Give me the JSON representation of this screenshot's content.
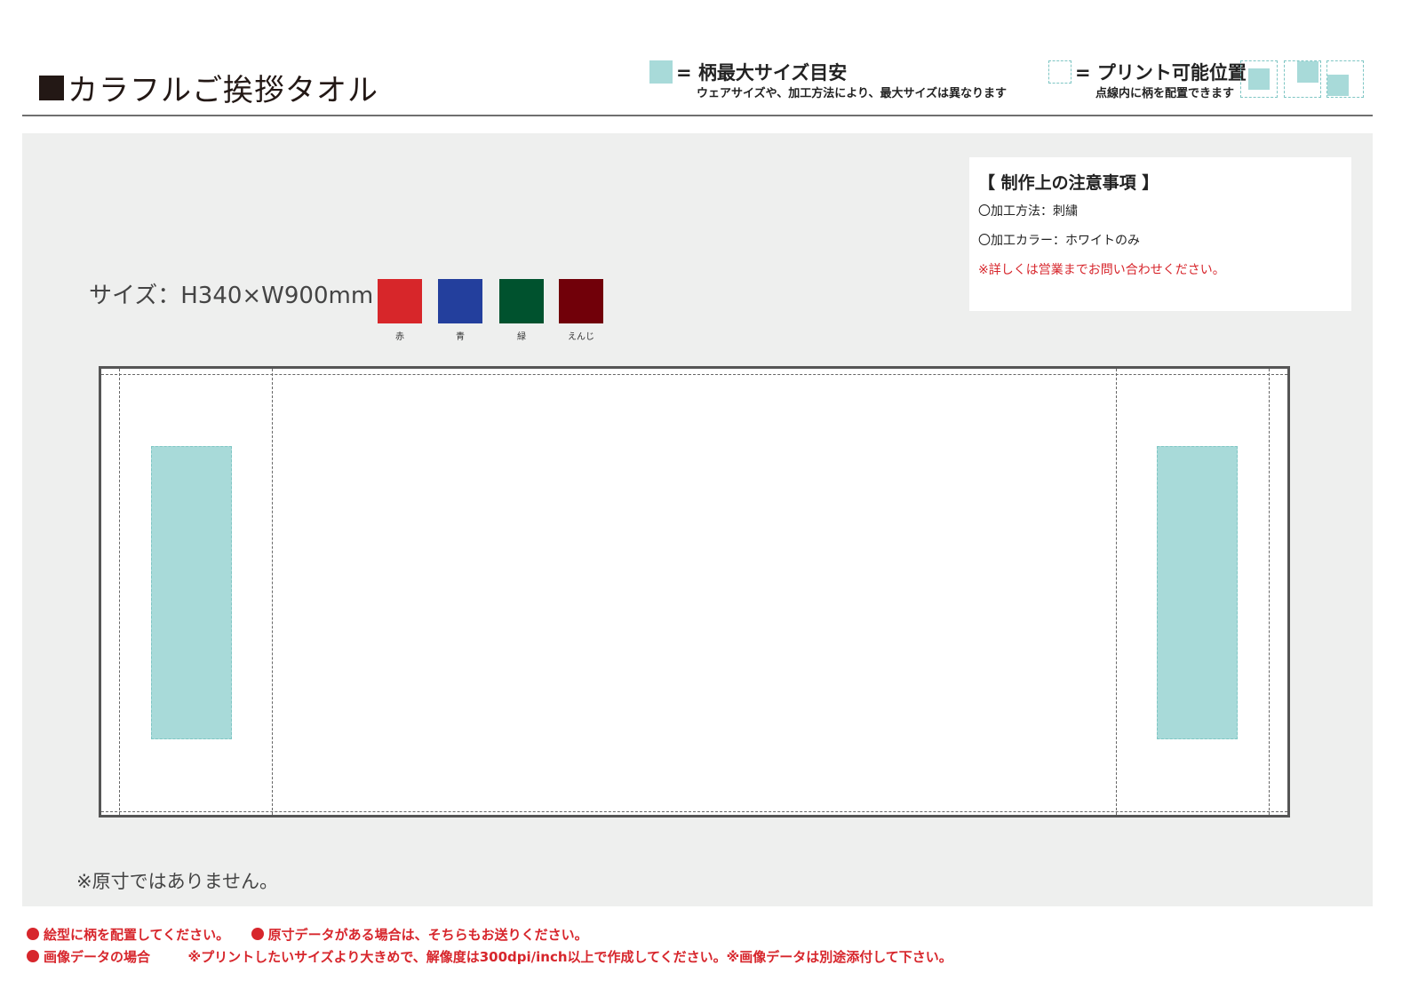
{
  "header": {
    "title": "カラフルご挨拶タオル",
    "legend_max": {
      "title": "= 柄最大サイズ目安",
      "note": "ウェアサイズや、加工方法により、最大サイズは異なります"
    },
    "legend_print": {
      "title": "= プリント可能位置",
      "note": "点線内に柄を配置できます"
    }
  },
  "product": {
    "size": "サイズ：H340×W900mm",
    "colors": [
      {
        "name": "赤",
        "hex": "#d7262a"
      },
      {
        "name": "青",
        "hex": "#233f9d"
      },
      {
        "name": "緑",
        "hex": "#00522e"
      },
      {
        "name": "えんじ",
        "hex": "#710009"
      }
    ]
  },
  "notes": {
    "title": "【 制作上の注意事項 】",
    "method": "〇加工方法：刺繍",
    "color": "〇加工カラー：ホワイトのみ",
    "warning": "※詳しくは営業までお問い合わせください。"
  },
  "scale_note": "※原寸ではありません。",
  "footer": {
    "line1_a": "絵型に柄を配置してください。",
    "line1_b": "原寸データがある場合は、そちらもお送りください。",
    "line2_a": "画像データの場合",
    "line2_b": "※プリントしたいサイズより大きめで、解像度は300dpi/inch以上で作成してください。※画像データは別途添付して下さい。"
  },
  "theme": {
    "max_area_color": "#a8dad9",
    "dash_color": "#7fc6c4",
    "warning_color": "#d7262c",
    "canvas_color": "#eeefee"
  }
}
